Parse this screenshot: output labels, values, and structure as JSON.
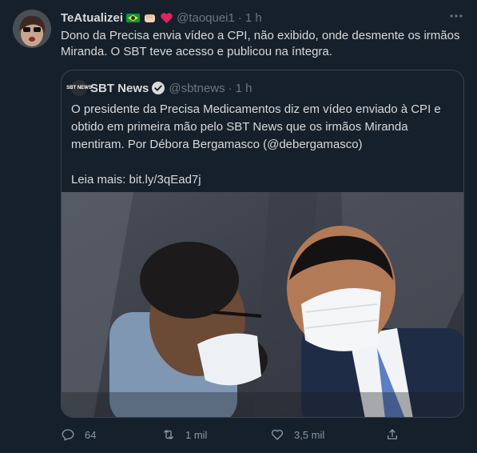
{
  "author": {
    "display_name": "TeAtualizei",
    "handle": "@taoquei1",
    "separator": "·",
    "time": "1 h",
    "text": "Dono da Precisa envia vídeo a CPI, não exibido, onde desmente os irmãos Miranda. O SBT teve acesso e publicou na íntegra.",
    "name_emojis": [
      "brazil-flag",
      "fist",
      "red-heart"
    ]
  },
  "quote": {
    "logo_text": "SBT NEWS",
    "name": "SBT News",
    "handle": "@sbtnews",
    "separator": "·",
    "time": "1 h",
    "text": "O presidente da Precisa Medicamentos diz em vídeo enviado à CPI e obtido em primeira mão pelo SBT News que os irmãos Miranda mentiram. Por Débora Bergamasco (@debergamasco)",
    "link_text": "Leia mais: bit.ly/3qEad7j"
  },
  "actions": {
    "replies": "64",
    "retweets": "1 mil",
    "likes": "3,5 mil"
  },
  "colors": {
    "background": "#15202b",
    "border": "#38444d",
    "muted": "#6e767d",
    "verified": "#d9d9d9"
  }
}
